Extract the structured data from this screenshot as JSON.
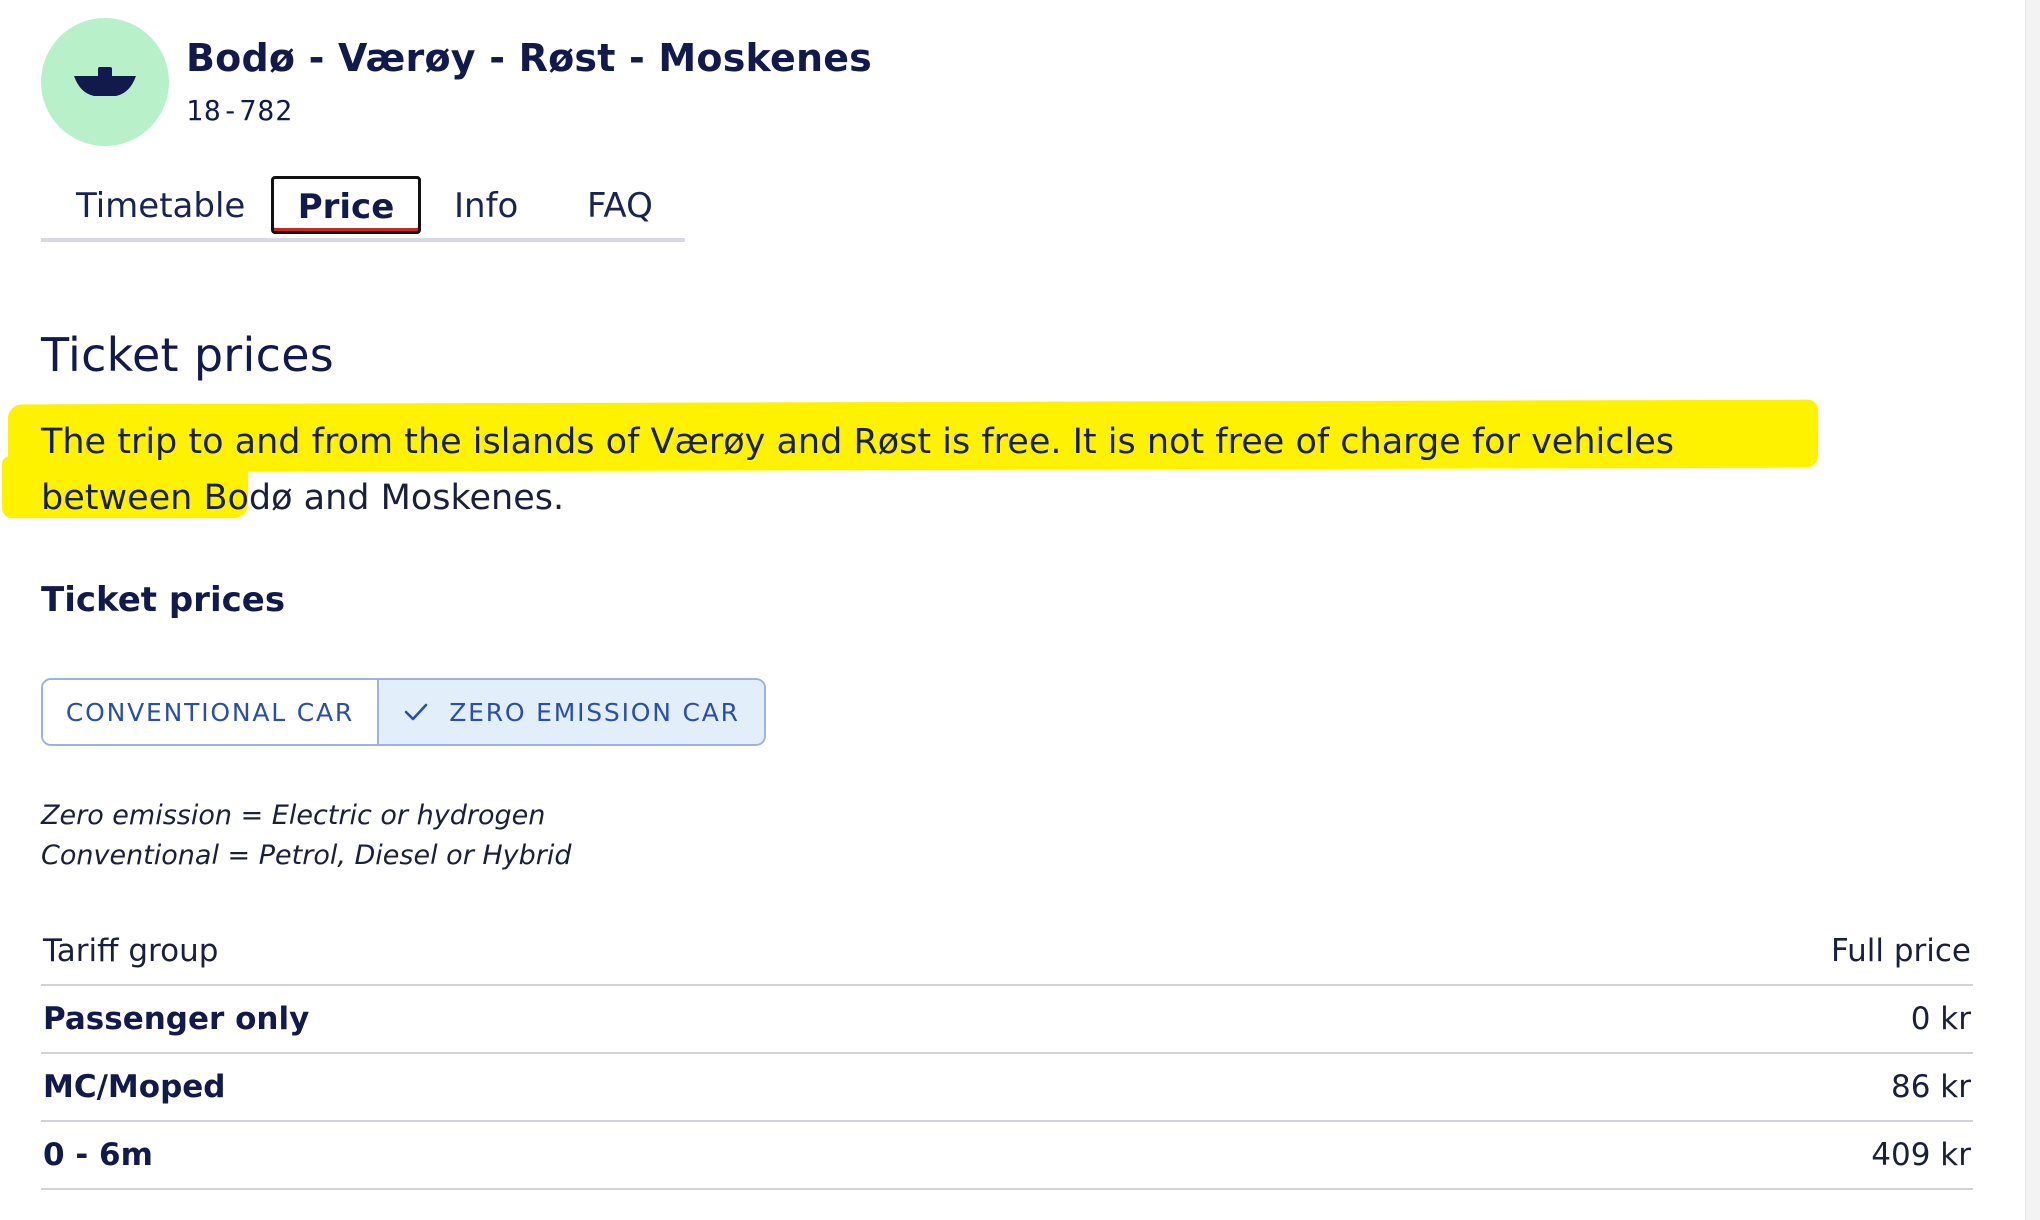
{
  "route": {
    "title": "Bodø - Værøy - Røst - Moskenes",
    "number": "18-782",
    "icon": "ferry-icon",
    "icon_bg": "#b7f0c9"
  },
  "tabs": [
    {
      "label": "Timetable",
      "active": false
    },
    {
      "label": "Price",
      "active": true
    },
    {
      "label": "Info",
      "active": false
    },
    {
      "label": "FAQ",
      "active": false
    }
  ],
  "page_title": "Ticket prices",
  "intro_text": "The trip to and from the islands of Værøy and Røst is free. It is not free of charge for vehicles between Bodø and Moskenes.",
  "highlight_color": "#fff200",
  "section_title": "Ticket prices",
  "vehicle_toggle": {
    "options": [
      {
        "label": "CONVENTIONAL CAR",
        "selected": false
      },
      {
        "label": "ZERO EMISSION CAR",
        "selected": true
      }
    ]
  },
  "notes": {
    "zero_emission": "Zero emission = Electric or hydrogen",
    "conventional": "Conventional = Petrol, Diesel or Hybrid"
  },
  "price_table": {
    "headers": {
      "group": "Tariff group",
      "price": "Full price"
    },
    "rows": [
      {
        "group": "Passenger only",
        "price": "0 kr"
      },
      {
        "group": "MC/Moped",
        "price": "86 kr"
      },
      {
        "group": "0 - 6m",
        "price": "409 kr"
      }
    ]
  }
}
